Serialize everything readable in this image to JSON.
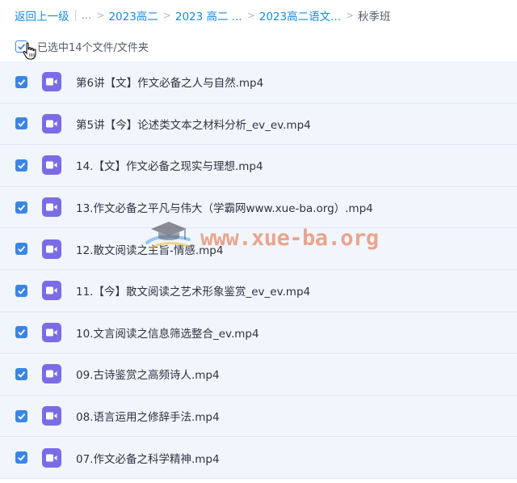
{
  "breadcrumb": {
    "back": "返回上一级",
    "ellipsis": "...",
    "crumbs": [
      "2023高二",
      "2023 高二 ...",
      "2023高二语文..."
    ],
    "current": "秋季班"
  },
  "selection": {
    "text": "已选中14个文件/文件夹"
  },
  "files": [
    {
      "name": "第6讲【文】作文必备之人与自然.mp4"
    },
    {
      "name": "第5讲【今】论述类文本之材料分析_ev_ev.mp4"
    },
    {
      "name": "14.【文】作文必备之现实与理想.mp4"
    },
    {
      "name": "13.作文必备之平凡与伟大（学霸网www.xue-ba.org）.mp4"
    },
    {
      "name": "12.散文阅读之主旨-情感.mp4"
    },
    {
      "name": "11.【今】散文阅读之艺术形象鉴赏_ev_ev.mp4"
    },
    {
      "name": "10.文言阅读之信息筛选整合_ev.mp4"
    },
    {
      "name": "09.古诗鉴赏之高频诗人.mp4"
    },
    {
      "name": "08.语言运用之修辞手法.mp4"
    },
    {
      "name": "07.作文必备之科学精神.mp4"
    }
  ],
  "watermark": {
    "text": "www.xue-ba.org"
  },
  "colors": {
    "accent": "#3a86e6",
    "link": "#1a8ad8",
    "file_icon": "#7a6ce6",
    "row_bg": "#f1f6fd"
  },
  "icons": {
    "file": "video-file-icon",
    "check": "check-icon",
    "cursor": "hand-cursor-icon",
    "separator": "chevron-right-icon"
  }
}
